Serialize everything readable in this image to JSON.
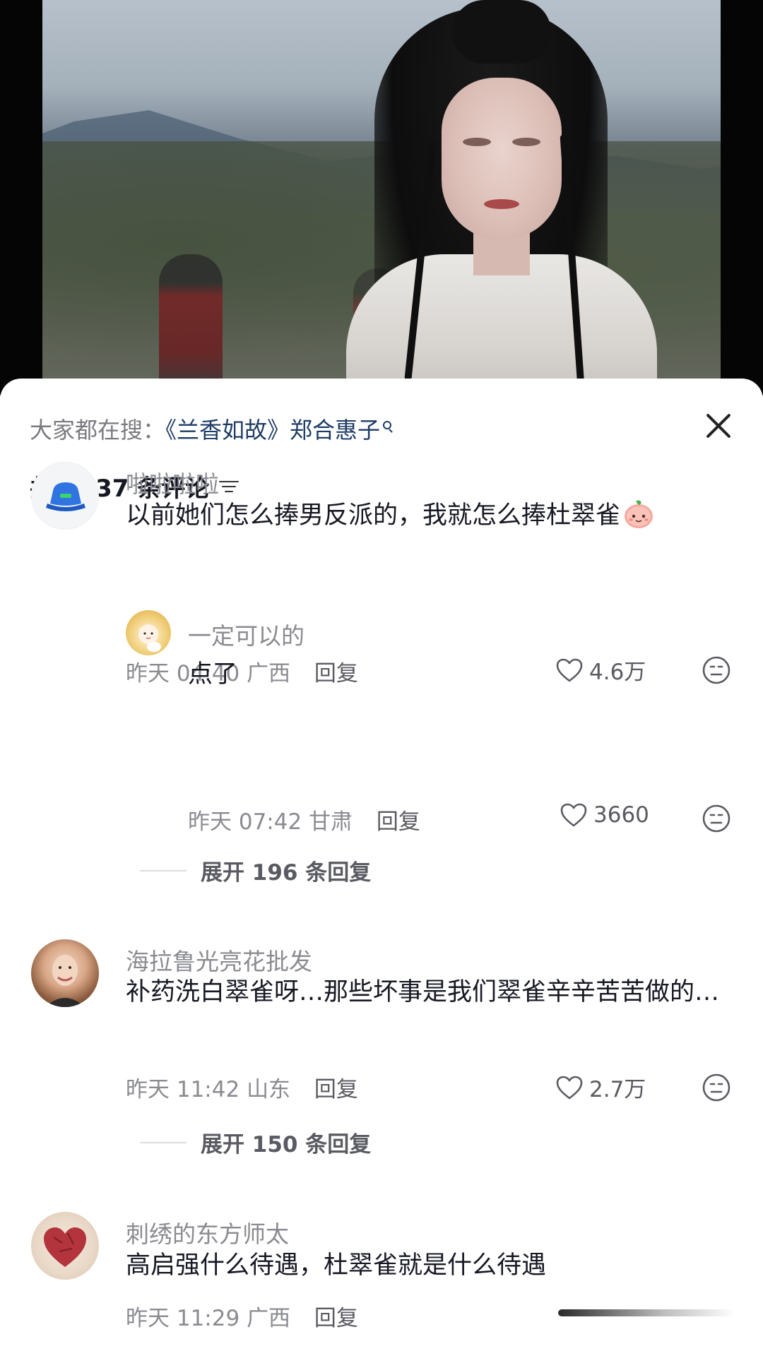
{
  "search_hint": {
    "prefix": "大家都在搜：",
    "term": "《兰香如故》郑合惠子"
  },
  "comments_header": {
    "count_text": "共 1737 条评论"
  },
  "comments": [
    {
      "author": "啦啦啦啦",
      "content": "以前她们怎么捧男反派的，我就怎么捧杜翠雀",
      "emoji": "peach-face-emoji",
      "time": "昨天 04:40",
      "location": "广西",
      "reply_label": "回复",
      "likes": "4.6万",
      "reply": {
        "author": "一定可以的",
        "content": "点了",
        "time": "昨天 07:42",
        "location": "甘肃",
        "reply_label": "回复",
        "likes": "3660"
      },
      "expand_label": "展开 196 条回复"
    },
    {
      "author": "海拉鲁光亮花批发",
      "content": "补药洗白翠雀呀…那些坏事是我们翠雀辛辛苦苦做的…",
      "time": "昨天 11:42",
      "location": "山东",
      "reply_label": "回复",
      "likes": "2.7万",
      "expand_label": "展开 150 条回复"
    },
    {
      "author": "刺绣的东方师太",
      "content": "高启强什么待遇，杜翠雀就是什么待遇",
      "time": "昨天 11:29",
      "location": "广西",
      "reply_label": "回复"
    }
  ],
  "icons": {
    "close": "close-icon",
    "sort": "sort-icon",
    "like": "heart-icon",
    "dislike": "dislike-face-icon"
  },
  "colors": {
    "search_term": "#1f3c66",
    "secondary_text": "#8a8b91",
    "primary_text": "#161823"
  }
}
